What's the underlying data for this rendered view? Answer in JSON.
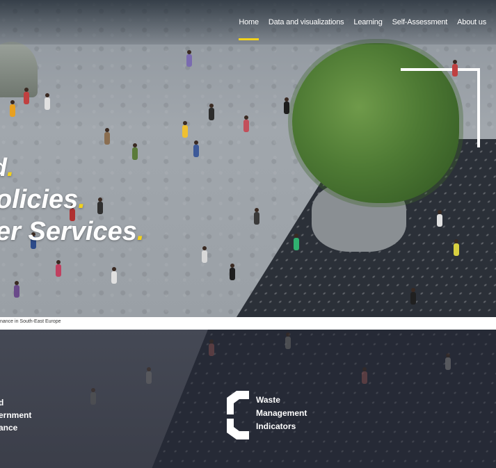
{
  "nav": {
    "items": [
      {
        "label": "Home",
        "active": true
      },
      {
        "label": "Data and visualizations",
        "active": false
      },
      {
        "label": "Learning",
        "active": false
      },
      {
        "label": "Self-Assessment",
        "active": false
      },
      {
        "label": "About us",
        "active": false
      }
    ]
  },
  "hero": {
    "line1": "d",
    "line2": "olicies",
    "line3": "er Services",
    "dot": ".",
    "caption": "nance in South-East Europe"
  },
  "cards": {
    "left": {
      "lines": [
        "d",
        "ernment",
        "ance"
      ]
    },
    "waste": {
      "lines": [
        "Waste",
        "Management",
        "Indicators"
      ]
    }
  },
  "colors": {
    "accent": "#f2d21b"
  }
}
